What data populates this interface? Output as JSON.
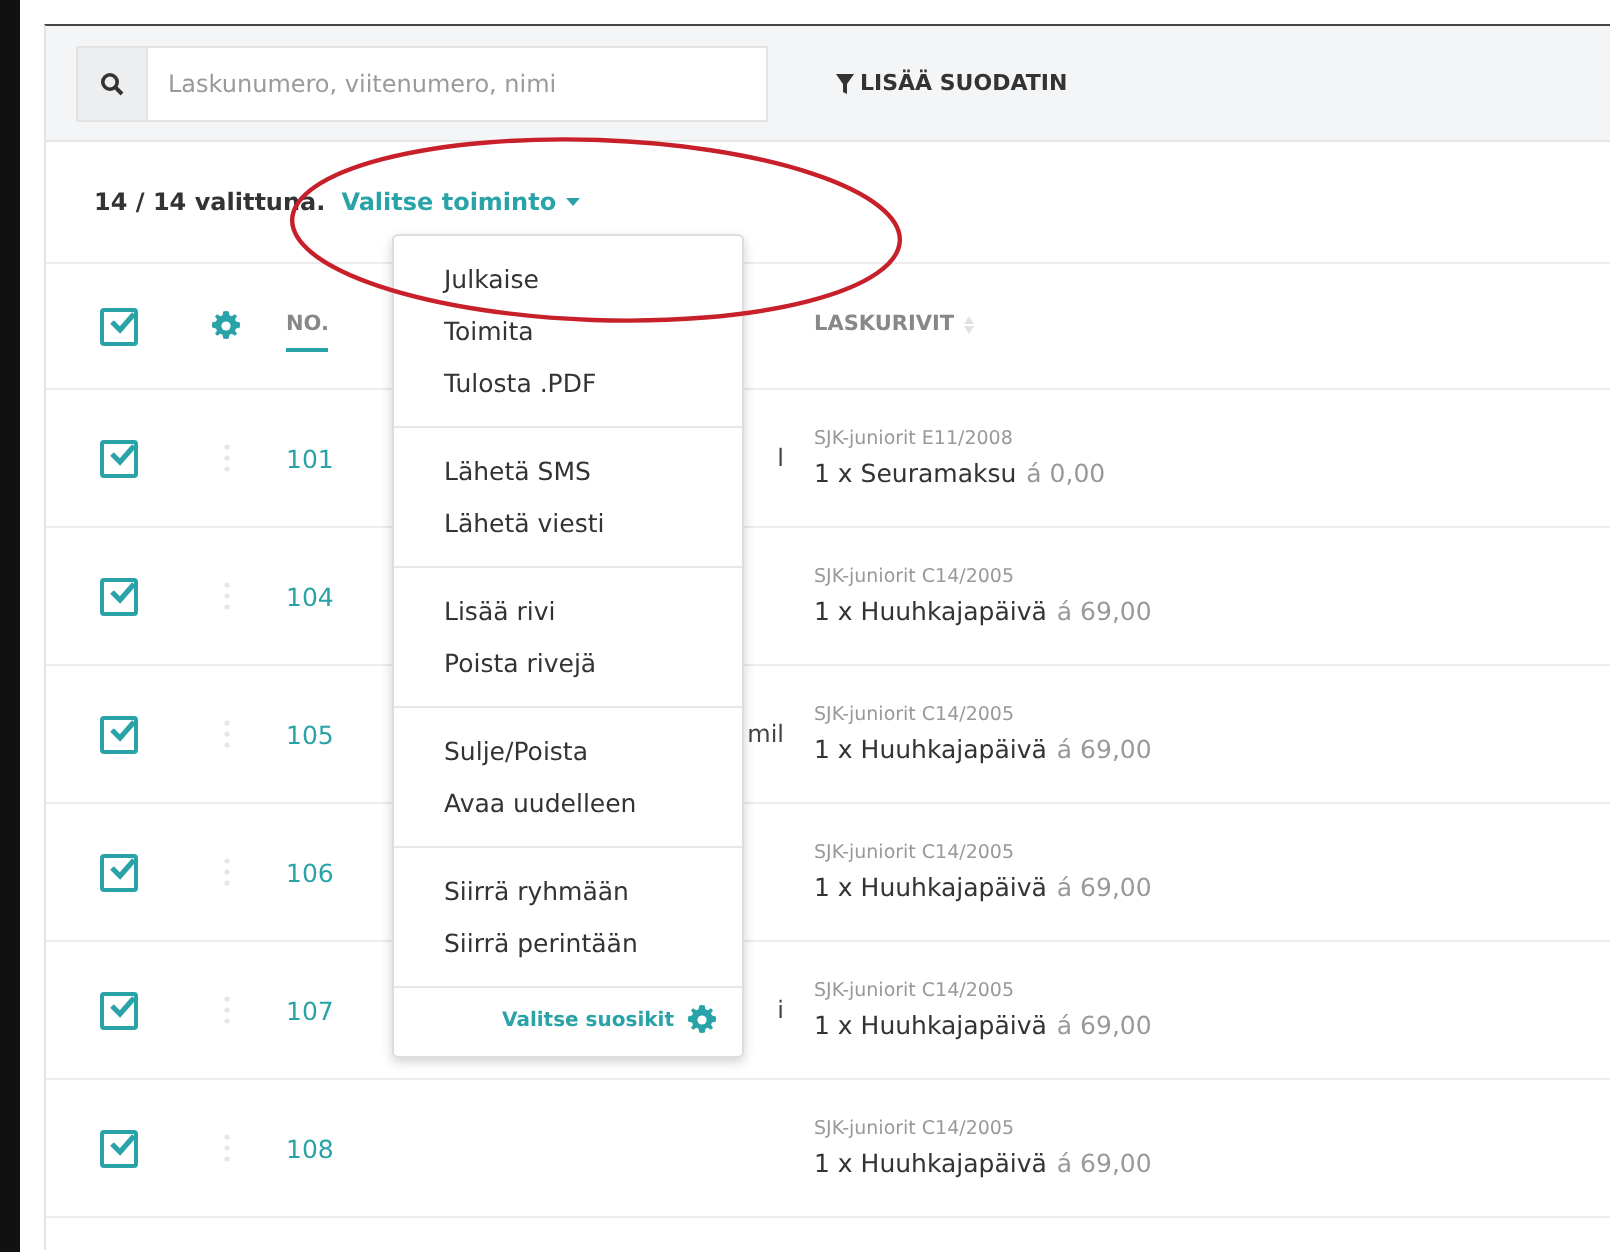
{
  "toolbar": {
    "search": {
      "placeholder": "Laskunumero, viitenumero, nimi"
    },
    "filter_button": "LISÄÄ SUODATIN"
  },
  "selection": {
    "count": "14 / 14 valittuna.",
    "action": "Valitse toiminto"
  },
  "table": {
    "header_checked": true,
    "columns": [
      {
        "label": "NO.",
        "selected": true
      },
      {
        "label": "LASKURIVIT",
        "selected": false
      }
    ],
    "rows": [
      {
        "checked": true,
        "number": "101",
        "column_3": "l",
        "group": "SJK-juniorit E11/2008",
        "item": "1 x Seuramaksu",
        "price": "á 0,00"
      },
      {
        "checked": true,
        "number": "104",
        "group": "SJK-juniorit C14/2005",
        "item": "1 x Huuhkajapäivä",
        "price": "á 69,00"
      },
      {
        "checked": true,
        "number": "105",
        "column_3": "mil",
        "group": "SJK-juniorit C14/2005",
        "item": "1 x Huuhkajapäivä",
        "price": "á 69,00"
      },
      {
        "checked": true,
        "number": "106",
        "group": "SJK-juniorit C14/2005",
        "item": "1 x Huuhkajapäivä",
        "price": "á 69,00"
      },
      {
        "checked": true,
        "number": "107",
        "column_3": "i",
        "group": "SJK-juniorit C14/2005",
        "item": "1 x Huuhkajapäivä",
        "price": "á 69,00"
      },
      {
        "checked": true,
        "number": "108",
        "group": "SJK-juniorit C14/2005",
        "item": "1 x Huuhkajapäivä",
        "price": "á 69,00"
      }
    ]
  },
  "menu": {
    "groups": [
      [
        "Julkaise",
        "Toimita",
        "Tulosta .PDF"
      ],
      [
        "Lähetä SMS",
        "Lähetä viesti"
      ],
      [
        "Lisää rivi",
        "Poista rivejä"
      ],
      [
        "Sulje/Poista",
        "Avaa uudelleen"
      ],
      [
        "Siirrä ryhmään",
        "Siirrä perintään"
      ]
    ],
    "footer": "Valitse suosikit"
  }
}
